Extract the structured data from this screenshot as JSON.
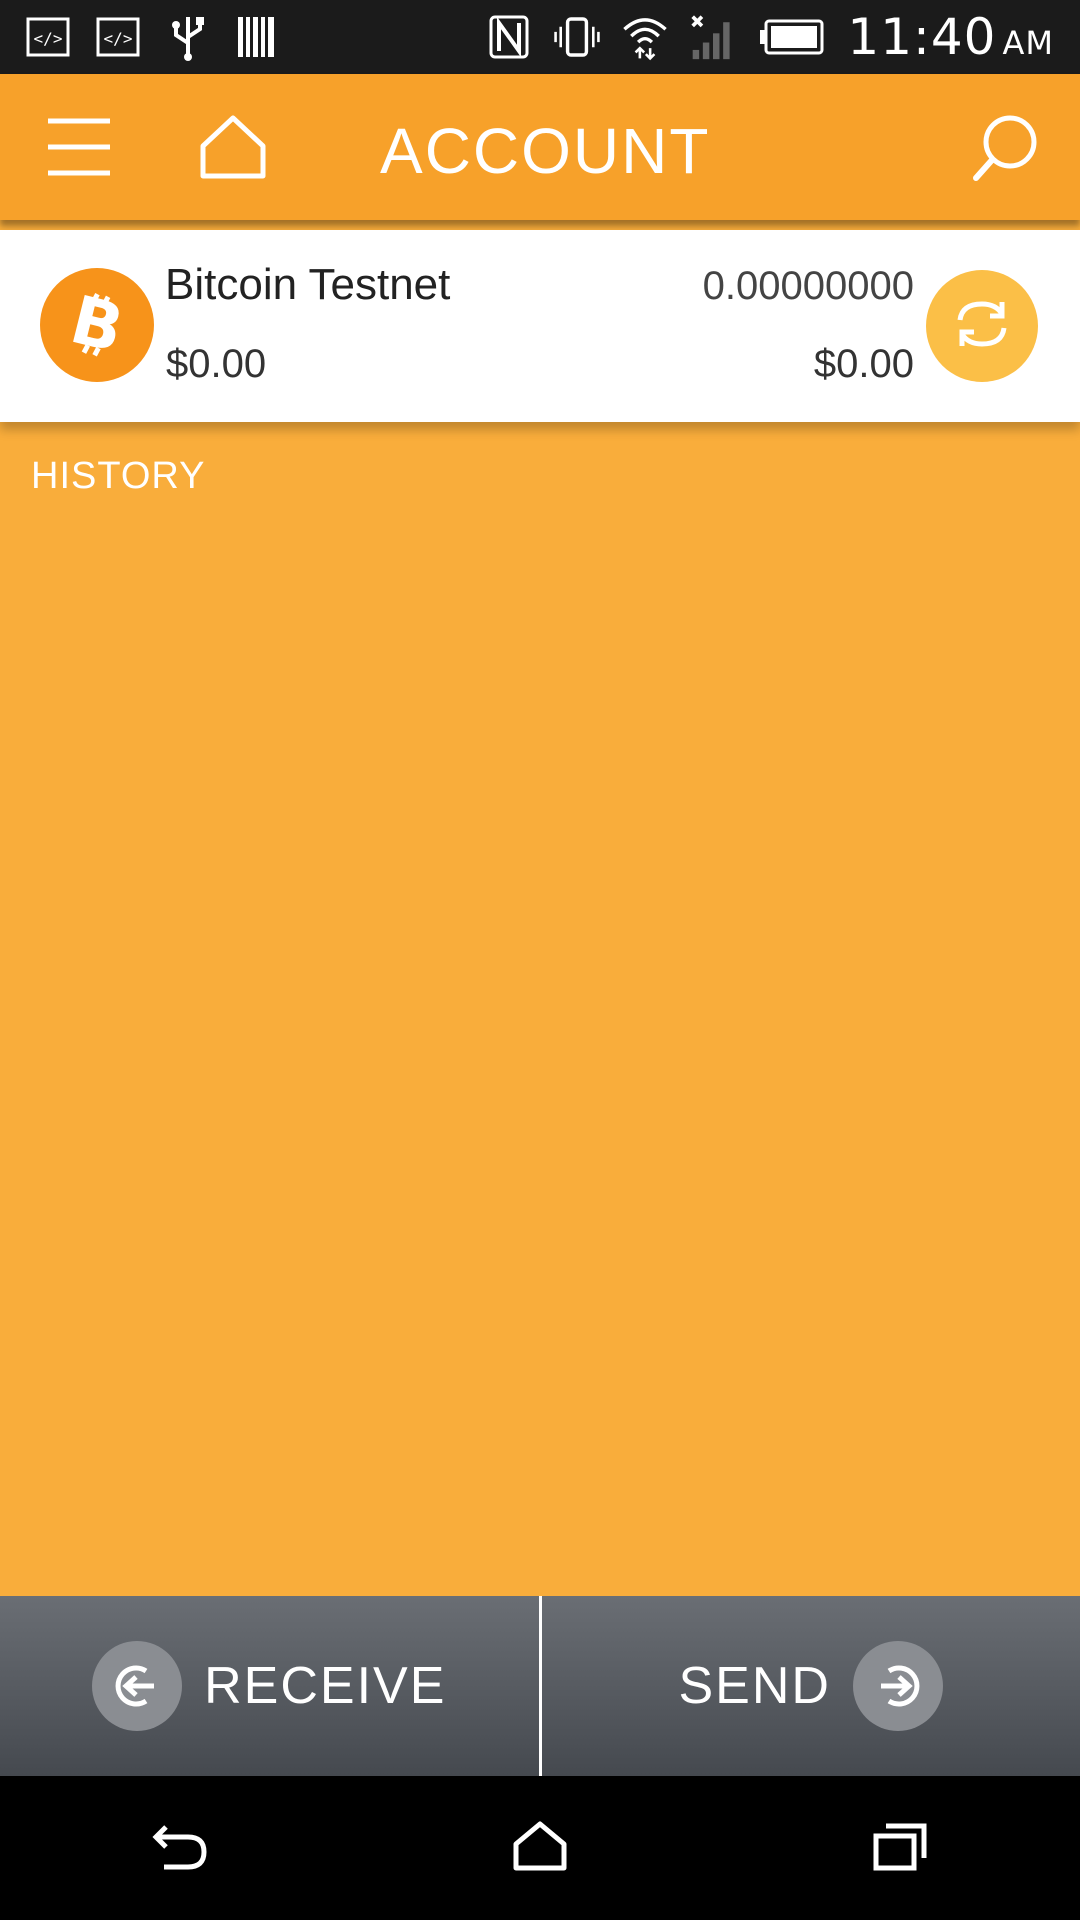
{
  "status_bar": {
    "time": "11:40",
    "ampm": "AM",
    "icons": [
      "code-icon",
      "code-icon",
      "usb-icon",
      "barcode-icon",
      "nfc-icon",
      "vibrate-icon",
      "wifi-icon",
      "signal-icon",
      "battery-icon"
    ]
  },
  "app_bar": {
    "title": "ACCOUNT",
    "menu_icon": "menu-icon",
    "home_icon": "home-icon",
    "search_icon": "search-icon"
  },
  "account": {
    "name": "Bitcoin Testnet",
    "fiat_value": "$0.00",
    "balance": "0.00000000",
    "balance_fiat": "$0.00",
    "coin_icon": "bitcoin-icon",
    "exchange_icon": "exchange-icon"
  },
  "history": {
    "label": "HISTORY"
  },
  "actions": {
    "receive_label": "RECEIVE",
    "send_label": "SEND"
  },
  "colors": {
    "primary": "#f7a12a",
    "background": "#f9ad3b",
    "bitcoin": "#f7931a",
    "exchange": "#fbbf47",
    "action_bar": "#55595f"
  },
  "nav_bar": {
    "back_icon": "back-icon",
    "home_icon": "home-icon",
    "recents_icon": "recents-icon"
  }
}
